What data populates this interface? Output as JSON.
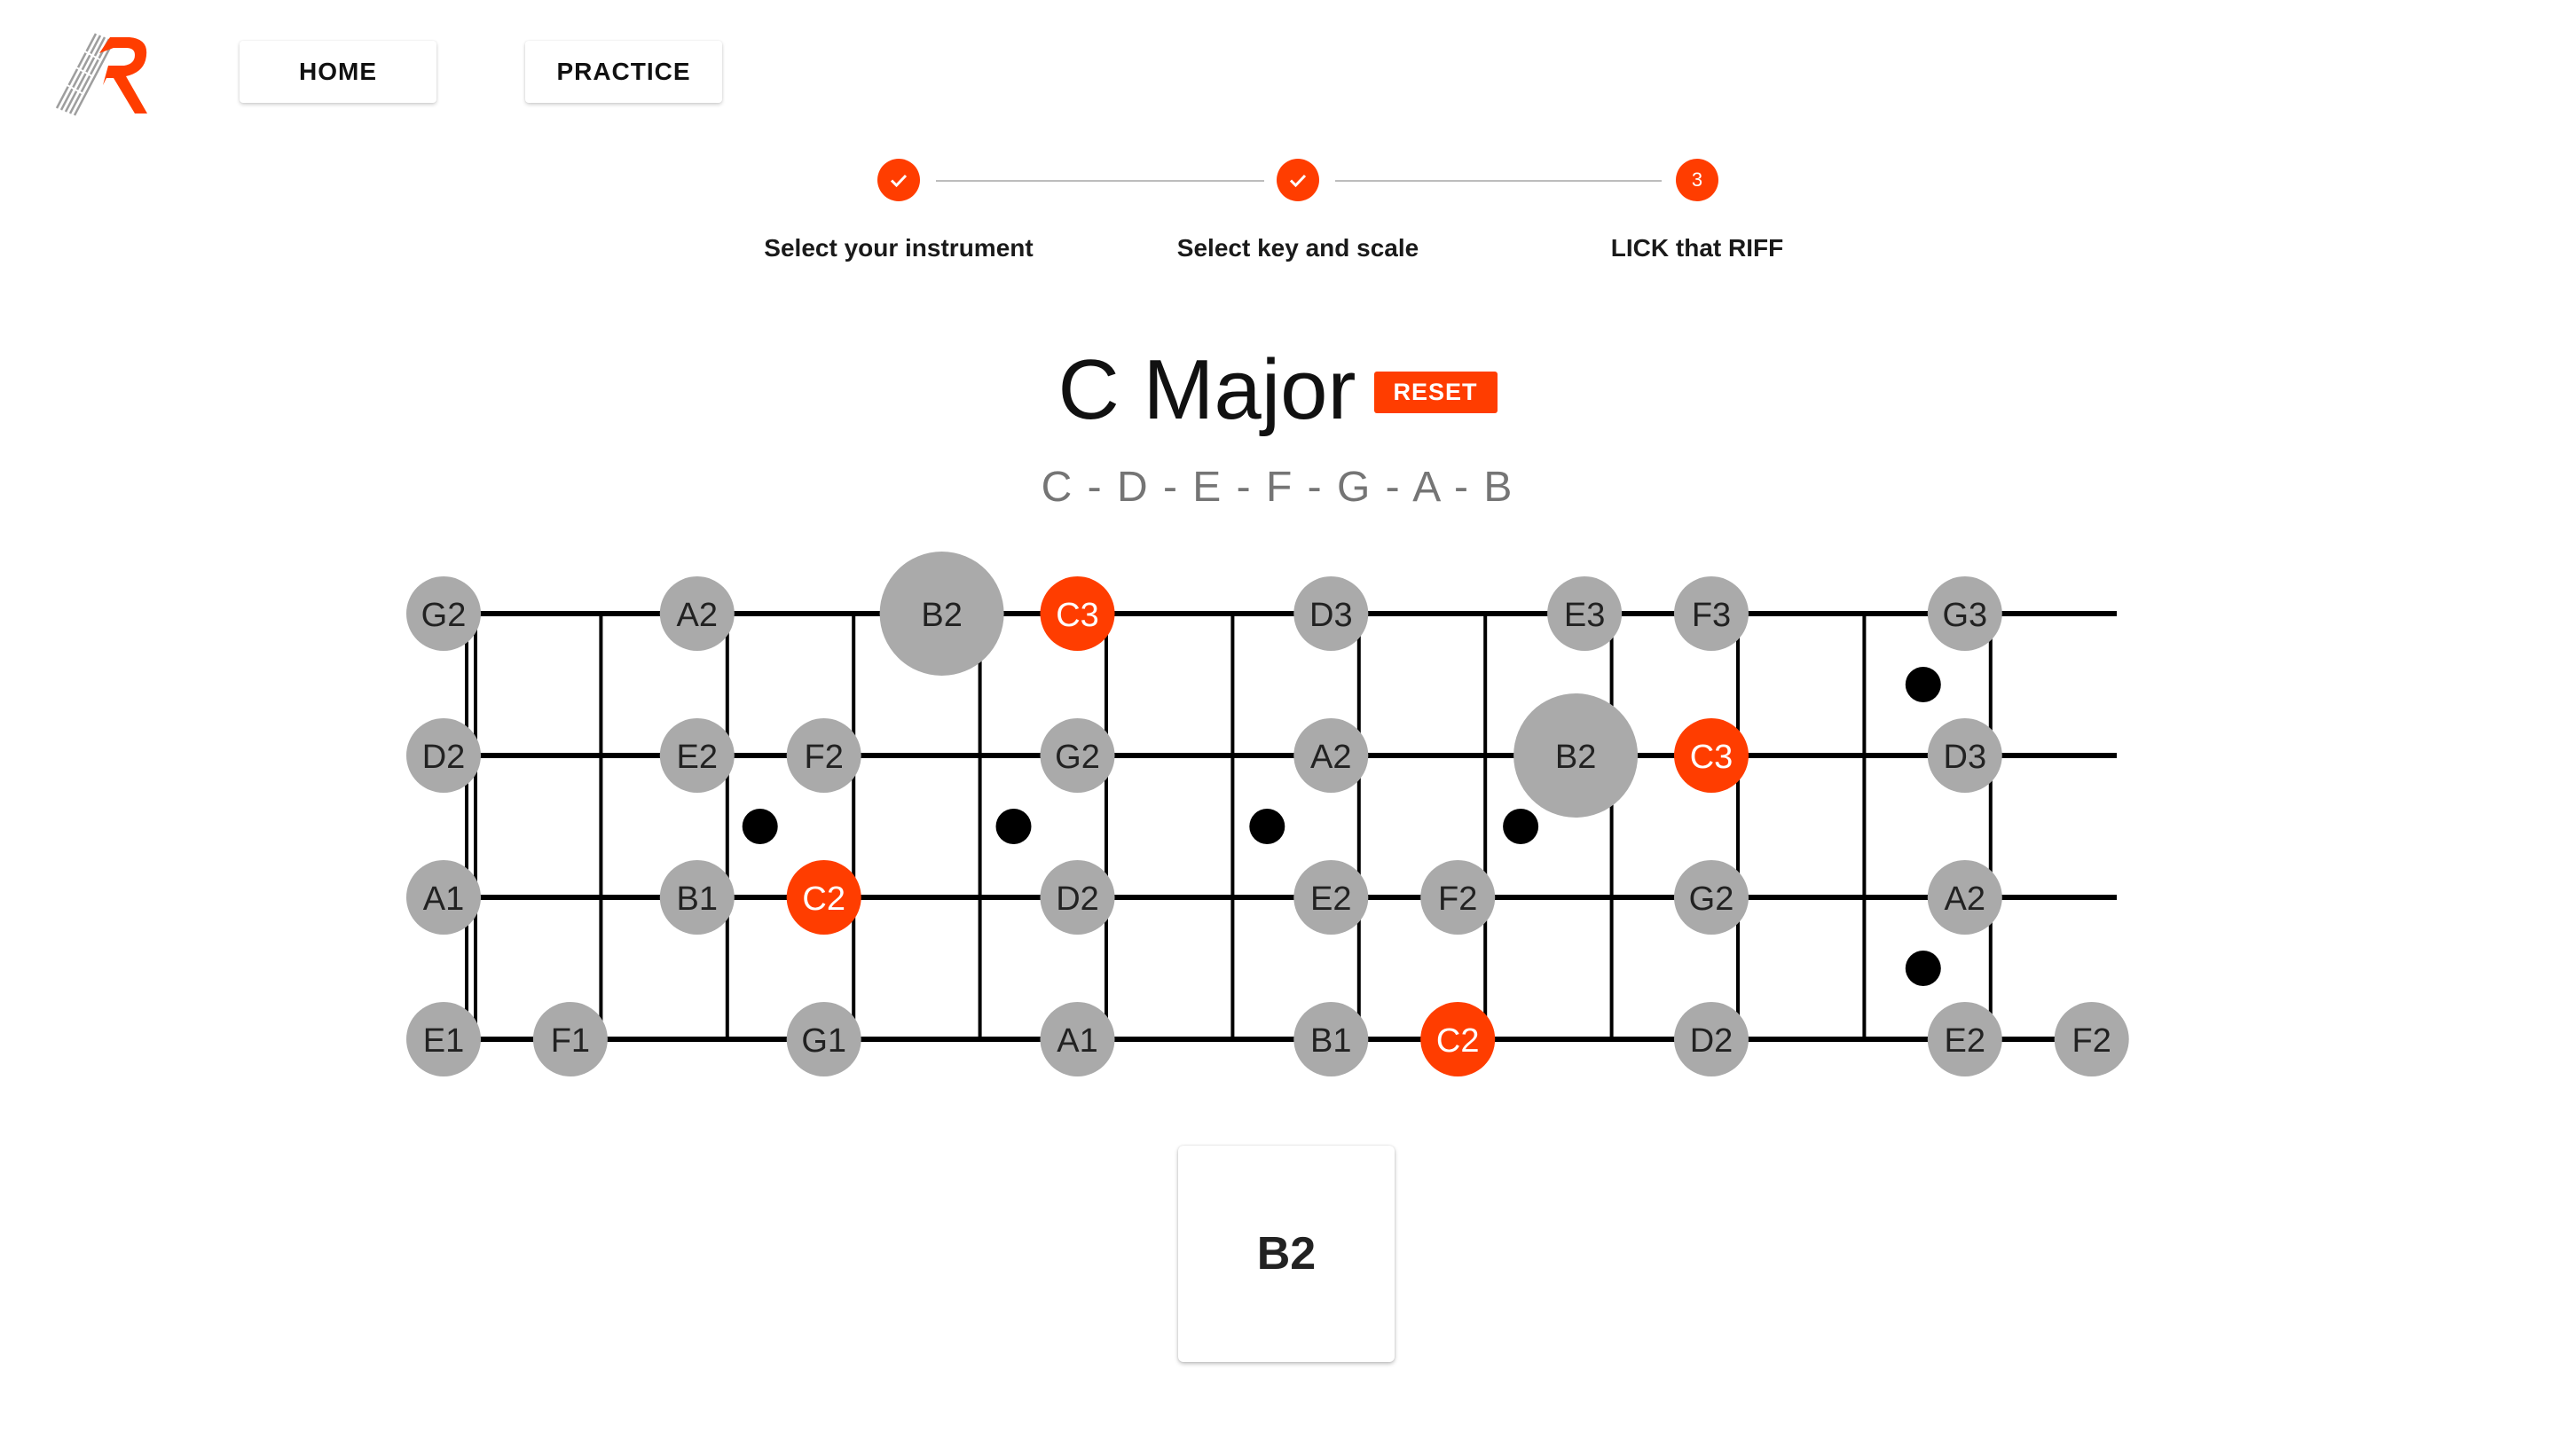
{
  "colors": {
    "accent": "#ff3d00",
    "note_default": "#aaaaaa",
    "note_root": "#ff3d00",
    "string_color": "#000000"
  },
  "nav": {
    "home_label": "HOME",
    "practice_label": "PRACTICE"
  },
  "stepper": {
    "steps": [
      {
        "label": "Select your instrument",
        "state": "completed",
        "icon": "check-icon"
      },
      {
        "label": "Select key and scale",
        "state": "completed",
        "icon": "check-icon"
      },
      {
        "label": "LICK that RIFF",
        "state": "active",
        "number": "3"
      }
    ]
  },
  "scale": {
    "title": "C Major",
    "reset_label": "RESET",
    "notes_text": "C - D - E - F - G - A - B"
  },
  "fretboard": {
    "strings": [
      {
        "notes": [
          {
            "fret": 0,
            "label": "G2",
            "root": false
          },
          {
            "fret": 2,
            "label": "A2",
            "root": false
          },
          {
            "fret": 4,
            "label": "B2",
            "root": false,
            "active": true
          },
          {
            "fret": 5,
            "label": "C3",
            "root": true
          },
          {
            "fret": 7,
            "label": "D3",
            "root": false
          },
          {
            "fret": 9,
            "label": "E3",
            "root": false
          },
          {
            "fret": 10,
            "label": "F3",
            "root": false
          },
          {
            "fret": 12,
            "label": "G3",
            "root": false
          }
        ]
      },
      {
        "notes": [
          {
            "fret": 0,
            "label": "D2",
            "root": false
          },
          {
            "fret": 2,
            "label": "E2",
            "root": false
          },
          {
            "fret": 3,
            "label": "F2",
            "root": false
          },
          {
            "fret": 5,
            "label": "G2",
            "root": false
          },
          {
            "fret": 7,
            "label": "A2",
            "root": false
          },
          {
            "fret": 9,
            "label": "B2",
            "root": false,
            "active": true
          },
          {
            "fret": 10,
            "label": "C3",
            "root": true
          },
          {
            "fret": 12,
            "label": "D3",
            "root": false
          }
        ]
      },
      {
        "notes": [
          {
            "fret": 0,
            "label": "A1",
            "root": false
          },
          {
            "fret": 2,
            "label": "B1",
            "root": false
          },
          {
            "fret": 3,
            "label": "C2",
            "root": true
          },
          {
            "fret": 5,
            "label": "D2",
            "root": false
          },
          {
            "fret": 7,
            "label": "E2",
            "root": false
          },
          {
            "fret": 8,
            "label": "F2",
            "root": false
          },
          {
            "fret": 10,
            "label": "G2",
            "root": false
          },
          {
            "fret": 12,
            "label": "A2",
            "root": false
          }
        ]
      },
      {
        "notes": [
          {
            "fret": 0,
            "label": "E1",
            "root": false
          },
          {
            "fret": 1,
            "label": "F1",
            "root": false
          },
          {
            "fret": 3,
            "label": "G1",
            "root": false
          },
          {
            "fret": 5,
            "label": "A1",
            "root": false
          },
          {
            "fret": 7,
            "label": "B1",
            "root": false
          },
          {
            "fret": 8,
            "label": "C2",
            "root": true
          },
          {
            "fret": 10,
            "label": "D2",
            "root": false
          },
          {
            "fret": 12,
            "label": "E2",
            "root": false
          },
          {
            "fret": 13,
            "label": "F2",
            "root": false
          }
        ]
      }
    ],
    "single_dot_frets": [
      3,
      5,
      7,
      9
    ],
    "double_dot_frets": [
      12
    ]
  },
  "current_note": "B2"
}
